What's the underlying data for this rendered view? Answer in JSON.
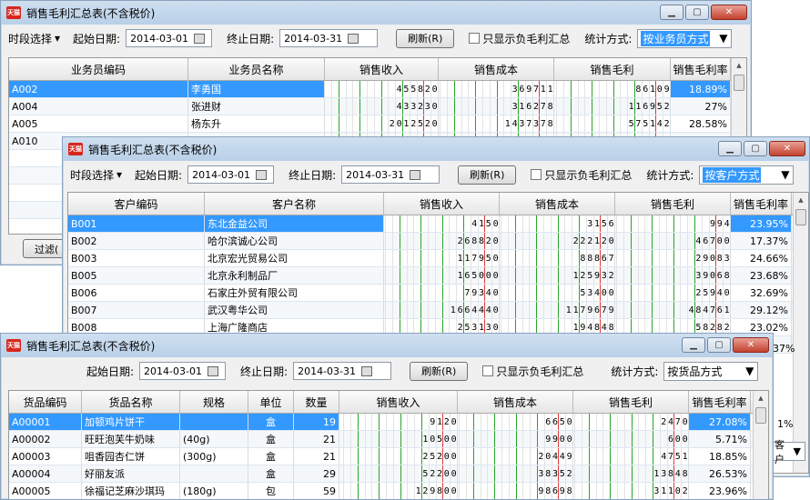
{
  "window1": {
    "title": "销售毛利汇总表(不含税价)",
    "period_select": "时段选择",
    "start_label": "起始日期:",
    "start_value": "2014-03-01",
    "end_label": "终止日期:",
    "end_value": "2014-03-31",
    "refresh": "刷新(R)",
    "neg_only": "只显示负毛利汇总",
    "stat_label": "统计方式:",
    "stat_value": "按业务员方式",
    "columns": [
      "业务员编码",
      "业务员名称",
      "销售收入",
      "销售成本",
      "销售毛利",
      "销售毛利率"
    ],
    "rows": [
      {
        "code": "A002",
        "name": "李勇国",
        "income": "455820",
        "cost": "369711",
        "profit": "86109",
        "rate": "18.89%"
      },
      {
        "code": "A004",
        "name": "张进财",
        "income": "433230",
        "cost": "316278",
        "profit": "116952",
        "rate": "27%"
      },
      {
        "code": "A005",
        "name": "杨东升",
        "income": "2012520",
        "cost": "1437378",
        "profit": "575142",
        "rate": "28.58%"
      },
      {
        "code": "A010",
        "name": "",
        "income": "",
        "cost": "",
        "profit": "",
        "rate": ""
      }
    ],
    "filter_btn": "过滤("
  },
  "window2": {
    "title": "销售毛利汇总表(不含税价)",
    "period_select": "时段选择",
    "start_label": "起始日期:",
    "start_value": "2014-03-01",
    "end_label": "终止日期:",
    "end_value": "2014-03-31",
    "refresh": "刷新(R)",
    "neg_only": "只显示负毛利汇总",
    "stat_label": "统计方式:",
    "stat_value": "按客户方式",
    "columns": [
      "客户编码",
      "客户名称",
      "销售收入",
      "销售成本",
      "销售毛利",
      "销售毛利率"
    ],
    "rows": [
      {
        "code": "B001",
        "name": "东北金益公司",
        "income": "4150",
        "cost": "3156",
        "profit": "994",
        "rate": "23.95%"
      },
      {
        "code": "B002",
        "name": "哈尔滨诚心公司",
        "income": "268820",
        "cost": "222120",
        "profit": "46700",
        "rate": "17.37%"
      },
      {
        "code": "B003",
        "name": "北京宏光贸易公司",
        "income": "117950",
        "cost": "88867",
        "profit": "29083",
        "rate": "24.66%"
      },
      {
        "code": "B005",
        "name": "北京永利制品厂",
        "income": "165000",
        "cost": "125932",
        "profit": "39068",
        "rate": "23.68%"
      },
      {
        "code": "B006",
        "name": "石家庄外贸有限公司",
        "income": "79340",
        "cost": "53400",
        "profit": "25940",
        "rate": "32.69%"
      },
      {
        "code": "B007",
        "name": "武汉粤华公司",
        "income": "1664440",
        "cost": "1179679",
        "profit": "484761",
        "rate": "29.12%"
      },
      {
        "code": "B008",
        "name": "上海广隆商店",
        "income": "253130",
        "cost": "194848",
        "profit": "58282",
        "rate": "23.02%"
      }
    ],
    "side_rate1": "37%",
    "side_rate2": "1%",
    "side_select": "客户"
  },
  "window3": {
    "title": "销售毛利汇总表(不含税价)",
    "start_label": "起始日期:",
    "start_value": "2014-03-01",
    "end_label": "终止日期:",
    "end_value": "2014-03-31",
    "refresh": "刷新(R)",
    "neg_only": "只显示负毛利汇总",
    "stat_label": "统计方式:",
    "stat_value": "按货品方式",
    "columns": [
      "货品编码",
      "货品名称",
      "规格",
      "单位",
      "数量",
      "销售收入",
      "销售成本",
      "销售毛利",
      "销售毛利率"
    ],
    "rows": [
      {
        "code": "A00001",
        "name": "加顿鸡片饼干",
        "spec": "",
        "unit": "盒",
        "qty": "19",
        "income": "9120",
        "cost": "6650",
        "profit": "2470",
        "rate": "27.08%"
      },
      {
        "code": "A00002",
        "name": "旺旺泡芙牛奶味",
        "spec": "(40g)",
        "unit": "盒",
        "qty": "21",
        "income": "10500",
        "cost": "9900",
        "profit": "600",
        "rate": "5.71%"
      },
      {
        "code": "A00003",
        "name": "咀香园杏仁饼",
        "spec": "(300g)",
        "unit": "盒",
        "qty": "21",
        "income": "25200",
        "cost": "20449",
        "profit": "4751",
        "rate": "18.85%"
      },
      {
        "code": "A00004",
        "name": "好丽友派",
        "spec": "",
        "unit": "盒",
        "qty": "29",
        "income": "52200",
        "cost": "38352",
        "profit": "13848",
        "rate": "26.53%"
      },
      {
        "code": "A00005",
        "name": "徐福记芝麻沙琪玛",
        "spec": "(180g)",
        "unit": "包",
        "qty": "59",
        "income": "129800",
        "cost": "98698",
        "profit": "31102",
        "rate": "23.96%"
      }
    ]
  },
  "icons": {
    "app": "天猫",
    "minimize": "minimize-icon",
    "maximize": "maximize-icon",
    "close": "close-icon"
  }
}
